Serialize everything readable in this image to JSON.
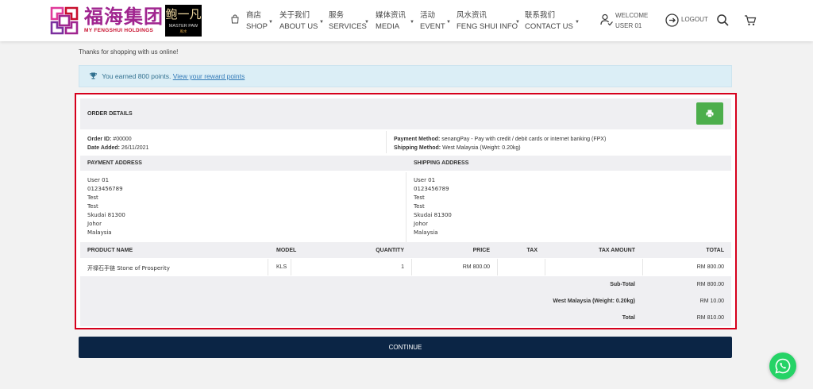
{
  "brand": {
    "logo_cn": "福海集团",
    "logo_en": "MY FENGSHUI HOLDINGS",
    "masterpaw_cn": "鲍一凡",
    "masterpaw_en": "MASTER PAW",
    "masterpaw_sub": "風水",
    "logo_color": "#a0258f"
  },
  "nav": [
    {
      "cn": "商店",
      "en": "SHOP"
    },
    {
      "cn": "关于我们",
      "en": "ABOUT US"
    },
    {
      "cn": "服务",
      "en": "SERVICES"
    },
    {
      "cn": "媒体资讯",
      "en": "MEDIA"
    },
    {
      "cn": "活动",
      "en": "EVENT"
    },
    {
      "cn": "风水资讯",
      "en": "FENG SHUI INFO"
    },
    {
      "cn": "联系我们",
      "en": "CONTACT US"
    }
  ],
  "user": {
    "welcome": "WELCOME",
    "name": "USER 01",
    "logout": "LOGOUT"
  },
  "page": {
    "thanks": "Thanks for shopping with us online!",
    "alert_text": "You earned 800 points.",
    "alert_link": "View your reward points",
    "continue": "CONTINUE"
  },
  "order": {
    "title": "ORDER DETAILS",
    "order_id_label": "Order ID:",
    "order_id": "#00000",
    "date_label": "Date Added:",
    "date": "26/11/2021",
    "payment_method_label": "Payment Method:",
    "payment_method": "senangPay - Pay with credit / debit cards or internet banking (FPX)",
    "shipping_method_label": "Shipping Method:",
    "shipping_method": "West Malaysia (Weight: 0.20kg)"
  },
  "addresses": {
    "payment_title": "PAYMENT ADDRESS",
    "shipping_title": "SHIPPING ADDRESS",
    "payment": [
      "User 01",
      "0123456789",
      "Test",
      "Test",
      "Skudai 81300",
      "Johor",
      "Malaysia"
    ],
    "shipping": [
      "User 01",
      "0123456789",
      "Test",
      "Test",
      "Skudai 81300",
      "Johor",
      "Malaysia"
    ]
  },
  "products": {
    "headers": {
      "name": "PRODUCT NAME",
      "model": "MODEL",
      "quantity": "QUANTITY",
      "price": "PRICE",
      "tax": "TAX",
      "tax_amount": "TAX AMOUNT",
      "total": "TOTAL"
    },
    "rows": [
      {
        "name": "开禄石手链 Stone of Prosperity",
        "model": "KLS",
        "quantity": "1",
        "price": "RM 800.00",
        "tax": "",
        "tax_amount": "",
        "total": "RM 800.00"
      }
    ]
  },
  "totals": [
    {
      "label": "Sub-Total",
      "value": "RM 800.00"
    },
    {
      "label": "West Malaysia (Weight: 0.20kg)",
      "value": "RM 10.00"
    },
    {
      "label": "Total",
      "value": "RM 810.00"
    }
  ],
  "colors": {
    "continue_bg": "#0b2545",
    "print_bg": "#4cae4c",
    "alert_bg": "#dbeef6",
    "highlight_border": "#d6001c",
    "whatsapp": "#25d366"
  },
  "icons": [
    "shopping-bag-icon",
    "user-check-icon",
    "logout-icon",
    "search-icon",
    "cart-icon",
    "trophy-icon",
    "print-icon",
    "whatsapp-icon"
  ]
}
